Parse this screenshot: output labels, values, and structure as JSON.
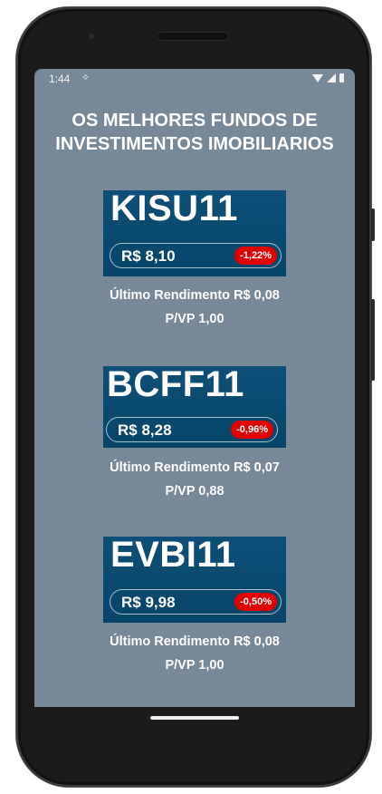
{
  "status": {
    "time": "1:44",
    "left_icon": "✧"
  },
  "title_line1": "OS MELHORES FUNDOS DE",
  "title_line2": "INVESTIMENTOS IMOBILIARIOS",
  "funds": [
    {
      "ticker": "KISU11",
      "price": "R$ 8,10",
      "change": "-1,22%",
      "rendimento": "Último Rendimento R$ 0,08",
      "pvp": "P/VP 1,00"
    },
    {
      "ticker": "BCFF11",
      "price": "R$ 8,28",
      "change": "-0,96%",
      "rendimento": "Último Rendimento R$ 0,07",
      "pvp": "P/VP 0,88"
    },
    {
      "ticker": "EVBI11",
      "price": "R$ 9,98",
      "change": "-0,50%",
      "rendimento": "Último Rendimento R$ 0,08",
      "pvp": "P/VP 1,00"
    }
  ],
  "colors": {
    "screen_bg": "#778899",
    "card_bg": "#064568",
    "negative": "#e00000"
  }
}
